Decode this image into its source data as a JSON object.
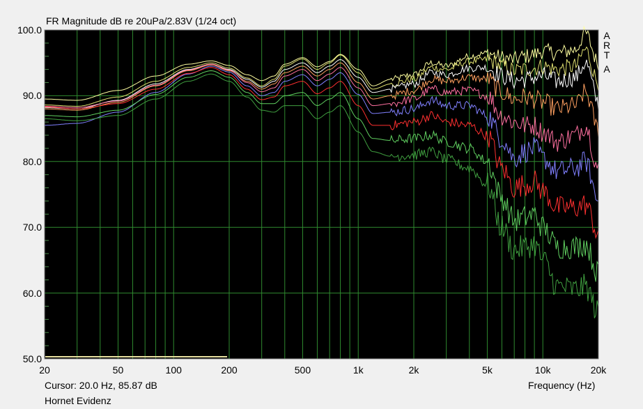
{
  "window": {
    "title": "FR Magnitude dB re 20uPa/2.83V (1/24 oct)",
    "cursor_readout": "Cursor: 20.0 Hz, 85.87 dB",
    "x_axis_label": "Frequency (Hz)",
    "device_name": "Hornet Evidenz",
    "watermark": [
      "A",
      "R",
      "T",
      "A"
    ]
  },
  "chart_data": {
    "type": "line",
    "title": "FR Magnitude dB re 20uPa/2.83V (1/24 oct)",
    "xlabel": "Frequency (Hz)",
    "ylabel": "",
    "xscale": "log",
    "xlim": [
      20,
      20000
    ],
    "ylim": [
      50,
      100
    ],
    "grid": true,
    "x_tick_labels": [
      "20",
      "50",
      "100",
      "200",
      "500",
      "1k",
      "2k",
      "5k",
      "10k",
      "20k"
    ],
    "x_tick_values": [
      20,
      50,
      100,
      200,
      500,
      1000,
      2000,
      5000,
      10000,
      20000
    ],
    "y_tick_labels": [
      "100.0",
      "90.0",
      "80.0",
      "70.0",
      "60.0",
      "50.0"
    ],
    "y_tick_values": [
      100,
      90,
      80,
      70,
      60,
      50
    ],
    "x": [
      20,
      30,
      50,
      80,
      120,
      160,
      200,
      250,
      300,
      350,
      400,
      500,
      600,
      700,
      800,
      1000,
      1200,
      1500,
      2000,
      2500,
      3000,
      4000,
      5000,
      6000,
      7000,
      8000,
      9000,
      10000,
      12000,
      15000,
      17000,
      20000
    ],
    "series": [
      {
        "color": "#ffffa0",
        "values": [
          89.5,
          89.3,
          90.8,
          93.0,
          94.8,
          95.3,
          94.6,
          93.2,
          92.3,
          93.0,
          94.8,
          95.8,
          94.4,
          95.2,
          96.3,
          94.0,
          91.5,
          92.5,
          93.2,
          95.0,
          94.5,
          96.0,
          96.5,
          95.8,
          95.5,
          96.0,
          96.3,
          96.8,
          96.5,
          97.0,
          99.5,
          95.0
        ]
      },
      {
        "color": "#e0e070",
        "values": [
          88.6,
          88.4,
          89.8,
          92.2,
          94.3,
          95.0,
          94.2,
          92.7,
          91.5,
          92.5,
          94.5,
          95.6,
          94.0,
          95.0,
          96.2,
          93.5,
          91.0,
          91.8,
          92.5,
          94.3,
          94.0,
          95.2,
          95.5,
          94.5,
          93.8,
          94.0,
          94.2,
          94.5,
          94.0,
          94.5,
          97.0,
          92.0
        ]
      },
      {
        "color": "#ffffff",
        "values": [
          88.2,
          88.0,
          89.3,
          91.8,
          94.0,
          94.8,
          94.0,
          92.5,
          91.3,
          92.2,
          94.0,
          95.0,
          93.5,
          94.5,
          95.5,
          92.8,
          90.5,
          91.0,
          91.8,
          93.5,
          93.2,
          94.2,
          94.3,
          93.0,
          92.3,
          92.5,
          92.8,
          93.0,
          92.2,
          92.8,
          95.0,
          89.0
        ]
      },
      {
        "color": "#ffa060",
        "values": [
          88.0,
          87.8,
          89.0,
          91.5,
          93.8,
          94.7,
          93.8,
          92.2,
          91.0,
          91.8,
          93.5,
          94.5,
          93.0,
          94.0,
          95.0,
          92.0,
          89.5,
          90.0,
          90.8,
          92.5,
          92.2,
          92.8,
          92.5,
          90.5,
          89.5,
          89.8,
          89.5,
          89.0,
          88.0,
          88.5,
          90.5,
          85.0
        ]
      },
      {
        "color": "#ff70a0",
        "values": [
          88.4,
          88.2,
          89.2,
          91.6,
          93.9,
          94.8,
          93.9,
          92.0,
          90.6,
          91.2,
          93.0,
          94.0,
          92.3,
          93.3,
          94.3,
          91.2,
          88.5,
          88.8,
          89.5,
          91.0,
          90.5,
          90.8,
          90.0,
          87.0,
          86.0,
          85.5,
          85.5,
          84.5,
          83.0,
          84.0,
          85.5,
          79.0
        ]
      },
      {
        "color": "#8080ff",
        "values": [
          85.5,
          85.8,
          87.5,
          90.5,
          93.3,
          94.5,
          93.6,
          91.5,
          90.0,
          90.5,
          92.2,
          93.2,
          91.5,
          92.5,
          93.5,
          90.2,
          87.3,
          87.5,
          88.0,
          89.3,
          88.5,
          88.5,
          87.0,
          83.5,
          80.5,
          81.5,
          82.0,
          80.5,
          78.5,
          79.0,
          80.0,
          74.0
        ]
      },
      {
        "color": "#ff3030",
        "values": [
          88.3,
          88.0,
          88.8,
          91.0,
          93.4,
          94.3,
          93.2,
          91.0,
          89.4,
          89.8,
          91.5,
          92.2,
          90.3,
          91.2,
          92.2,
          88.5,
          85.5,
          85.5,
          86.0,
          87.0,
          86.0,
          85.5,
          84.0,
          79.0,
          76.0,
          76.5,
          77.0,
          75.5,
          73.0,
          73.0,
          73.5,
          69.0
        ]
      },
      {
        "color": "#60d060",
        "values": [
          87.0,
          86.8,
          87.8,
          90.2,
          92.8,
          93.8,
          92.8,
          90.5,
          88.8,
          88.8,
          90.0,
          90.5,
          88.5,
          89.5,
          90.5,
          86.5,
          83.5,
          83.2,
          83.5,
          84.0,
          83.0,
          82.0,
          80.0,
          74.5,
          71.0,
          71.5,
          72.0,
          70.0,
          67.0,
          67.0,
          67.5,
          63.0
        ]
      },
      {
        "color": "#40a040",
        "values": [
          86.5,
          86.2,
          87.0,
          89.5,
          92.2,
          93.3,
          92.2,
          89.8,
          87.8,
          87.5,
          88.5,
          88.5,
          86.5,
          87.5,
          88.5,
          84.5,
          81.5,
          80.8,
          81.0,
          81.5,
          80.3,
          79.0,
          76.5,
          70.0,
          66.5,
          67.0,
          67.5,
          65.0,
          61.0,
          60.5,
          61.0,
          57.0
        ]
      }
    ]
  }
}
